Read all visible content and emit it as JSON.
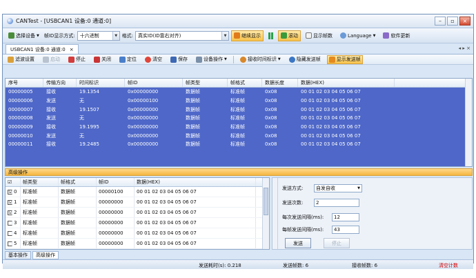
{
  "window": {
    "title": "CANTest - [USBCAN1 设备:0 通道:0]"
  },
  "main_toolbar": {
    "select_device": "选择设备",
    "id_display_label": "帧ID显示方式:",
    "id_display_value": "十六进制",
    "format_label": "格式:",
    "format_value": "真实ID(ID靠右对齐)",
    "continue_display": "继续显示",
    "scroll": "滚动",
    "show_frame_count": "显示帧数",
    "language": "Language",
    "software_update": "软件更新"
  },
  "doc_tab": {
    "label": "USBCAN1 设备:0 通道:0",
    "close": "×",
    "nav": "◂ ▸ ×"
  },
  "sub_toolbar": {
    "filter": "滤波设置",
    "start": "启动",
    "stop": "停止",
    "close": "关闭",
    "locate": "定位",
    "clear": "清空",
    "save": "保存",
    "device_ops": "设备操作",
    "recv_time": "接收时间标识",
    "hide_send": "隐藏发送帧",
    "show_send": "显示发送帧"
  },
  "grid": {
    "headers": [
      "序号",
      "传输方向",
      "时间标识",
      "帧ID",
      "帧类型",
      "帧格式",
      "数据长度",
      "数据(HEX)"
    ],
    "rows": [
      [
        "00000005",
        "接收",
        "19.1354",
        "0x00000000",
        "数据帧",
        "标准帧",
        "0x08",
        "00 01 02 03 04 05 06 07"
      ],
      [
        "00000006",
        "发送",
        "无",
        "0x00000100",
        "数据帧",
        "标准帧",
        "0x08",
        "00 01 02 03 04 05 06 07"
      ],
      [
        "00000007",
        "接收",
        "19.1507",
        "0x00000000",
        "数据帧",
        "标准帧",
        "0x08",
        "00 01 02 03 04 05 06 07"
      ],
      [
        "00000008",
        "发送",
        "无",
        "0x00000000",
        "数据帧",
        "标准帧",
        "0x08",
        "00 01 02 03 04 05 06 07"
      ],
      [
        "00000009",
        "接收",
        "19.1995",
        "0x00000000",
        "数据帧",
        "标准帧",
        "0x08",
        "00 01 02 03 04 05 06 07"
      ],
      [
        "00000010",
        "发送",
        "无",
        "0x00000000",
        "数据帧",
        "标准帧",
        "0x08",
        "00 01 02 03 04 05 06 07"
      ],
      [
        "00000011",
        "接收",
        "19.2485",
        "0x00000000",
        "数据帧",
        "标准帧",
        "0x08",
        "00 01 02 03 04 05 06 07"
      ]
    ]
  },
  "advanced_bar": {
    "label": "高级操作"
  },
  "send_grid": {
    "headers": [
      "☑",
      "帧类型",
      "帧格式",
      "帧ID",
      "数据(HEX)"
    ],
    "rows": [
      {
        "check": "☑",
        "index": "0",
        "type": "标准帧",
        "format": "数据帧",
        "id": "00000100",
        "data": "00 01 02 03 04 05 06 07"
      },
      {
        "check": "☑",
        "index": "1",
        "type": "标准帧",
        "format": "数据帧",
        "id": "00000000",
        "data": "00 01 02 03 04 05 06 07"
      },
      {
        "check": "☑",
        "index": "2",
        "type": "标准帧",
        "format": "数据帧",
        "id": "00000000",
        "data": "00 01 02 03 04 05 06 07"
      },
      {
        "check": "",
        "index": "3",
        "type": "标准帧",
        "format": "数据帧",
        "id": "00000000",
        "data": "00 01 02 03 04 05 06 07"
      },
      {
        "check": "",
        "index": "4",
        "type": "标准帧",
        "format": "数据帧",
        "id": "00000000",
        "data": "00 01 02 03 04 05 06 07"
      },
      {
        "check": "",
        "index": "5",
        "type": "标准帧",
        "format": "数据帧",
        "id": "00000000",
        "data": "00 01 02 03 04 05 06 07"
      }
    ]
  },
  "send_panel": {
    "mode_label": "发送方式:",
    "mode_value": "自发自收",
    "count_label": "发送次数:",
    "count_value": "2",
    "interval_label": "每次发送间隔(ms):",
    "interval_value": "12",
    "frame_interval_label": "每帧发送间隔(ms):",
    "frame_interval_value": "43",
    "send_button": "发送",
    "stop_button": "停止"
  },
  "bottom_tabs": {
    "basic": "基本操作",
    "advanced": "高级操作"
  },
  "status": {
    "send_time": "发送耗时(s): 0.218",
    "send_frames": "发送帧数: 6",
    "recv_frames": "接收帧数: 6",
    "clear_count": "清空计数"
  }
}
